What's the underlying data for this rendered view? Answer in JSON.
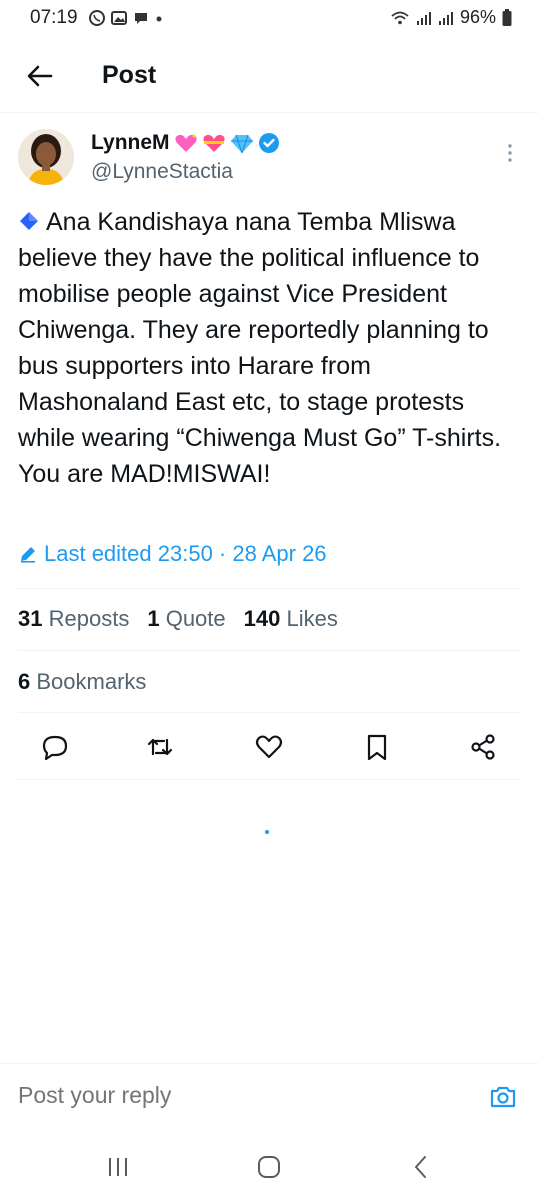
{
  "status_bar": {
    "time": "07:19",
    "battery": "96%",
    "icons": [
      "whatsapp-icon",
      "gallery-icon",
      "chat-icon",
      "dot-icon",
      "wifi-icon",
      "signal-icon",
      "signal-icon",
      "battery-icon"
    ]
  },
  "header": {
    "title": "Post",
    "back_icon": "back-arrow-icon"
  },
  "post": {
    "author_name": "LynneM",
    "author_emojis": [
      "sparkling-heart",
      "heart-with-ribbon",
      "gem-stone"
    ],
    "verified": true,
    "author_handle": "@LynneStactia",
    "text": "Ana Kandishaya nana Temba Mliswa believe they have the political influence to mobilise people against Vice President Chiwenga. They are reportedly planning to bus supporters into Harare from Mashonaland East etc, to stage protests while wearing “Chiwenga Must Go” T-shirts. You are MAD!MISWAI!",
    "edited_label": "Last edited 23:50 · 28 Apr 26"
  },
  "stats": {
    "reposts_count": "31",
    "reposts_label": "Reposts",
    "quotes_count": "1",
    "quotes_label": "Quote",
    "likes_count": "140",
    "likes_label": "Likes",
    "bookmarks_count": "6",
    "bookmarks_label": "Bookmarks"
  },
  "actions": [
    "reply-icon",
    "repost-icon",
    "like-icon",
    "bookmark-icon",
    "share-icon"
  ],
  "reply": {
    "placeholder": "Post your reply"
  },
  "colors": {
    "accent": "#1d9bf0",
    "text": "#0f1419",
    "secondary": "#536471"
  }
}
